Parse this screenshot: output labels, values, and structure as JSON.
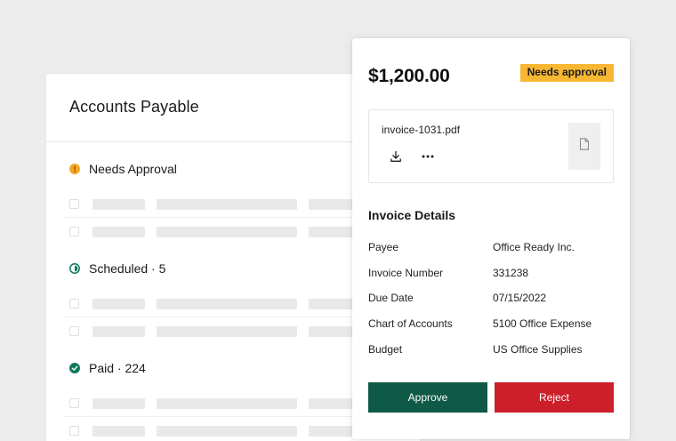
{
  "accounts_payable": {
    "title": "Accounts Payable",
    "sections": [
      {
        "label": "Needs Approval",
        "icon": "alert-circle-icon",
        "color": "#f5a623"
      },
      {
        "label": "Scheduled · 5",
        "icon": "clock-circle-icon",
        "color": "#0f7a5c"
      },
      {
        "label": "Paid · 224",
        "icon": "check-circle-icon",
        "color": "#0f7a5c"
      }
    ]
  },
  "invoice": {
    "amount": "$1,200.00",
    "status_badge": "Needs approval",
    "file": {
      "name": "invoice-1031.pdf",
      "download_icon": "download-icon",
      "more_icon": "more-horizontal-icon",
      "thumbnail_icon": "file-icon"
    },
    "details_title": "Invoice Details",
    "details": [
      {
        "label": "Payee",
        "value": "Office Ready Inc."
      },
      {
        "label": "Invoice Number",
        "value": "331238"
      },
      {
        "label": "Due Date",
        "value": "07/15/2022"
      },
      {
        "label": "Chart of Accounts",
        "value": "5100 Office Expense"
      },
      {
        "label": "Budget",
        "value": "US Office Supplies"
      }
    ],
    "approve_label": "Approve",
    "reject_label": "Reject"
  },
  "colors": {
    "badge": "#f7b733",
    "approve": "#0f5a47",
    "reject": "#cc1f2a"
  }
}
